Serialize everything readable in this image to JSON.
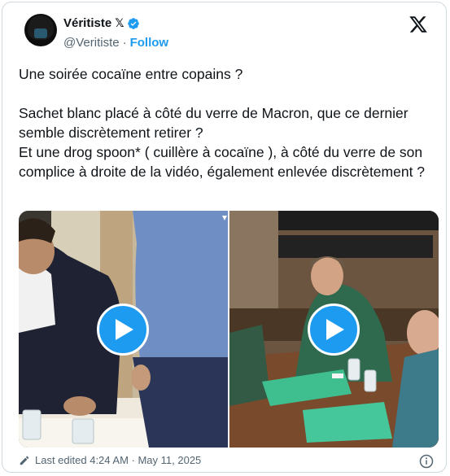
{
  "author": {
    "name": "Véritiste",
    "platform_mark": "𝕏",
    "handle": "@Veritiste",
    "separator": "·",
    "follow_label": "Follow"
  },
  "tweet": {
    "line1": "Une soirée cocaïne entre copains ?",
    "line2": "Sachet blanc placé à côté du verre de Macron, que ce dernier semble discrètement retirer ?",
    "line3": "Et une drog spoon* ( cuillère à cocaïne ), à côté du verre de son complice à droite de la vidéo, également enlevée discrètement ?"
  },
  "footer": {
    "edited_label": "Last edited 4:24 AM · May 11, 2025"
  },
  "colors": {
    "accent": "#1d9bf0",
    "muted_text": "#536471",
    "border": "#cfd9de"
  },
  "icons": [
    "verified-badge-icon",
    "x-logo-icon",
    "play-icon",
    "pencil-icon",
    "info-icon"
  ]
}
